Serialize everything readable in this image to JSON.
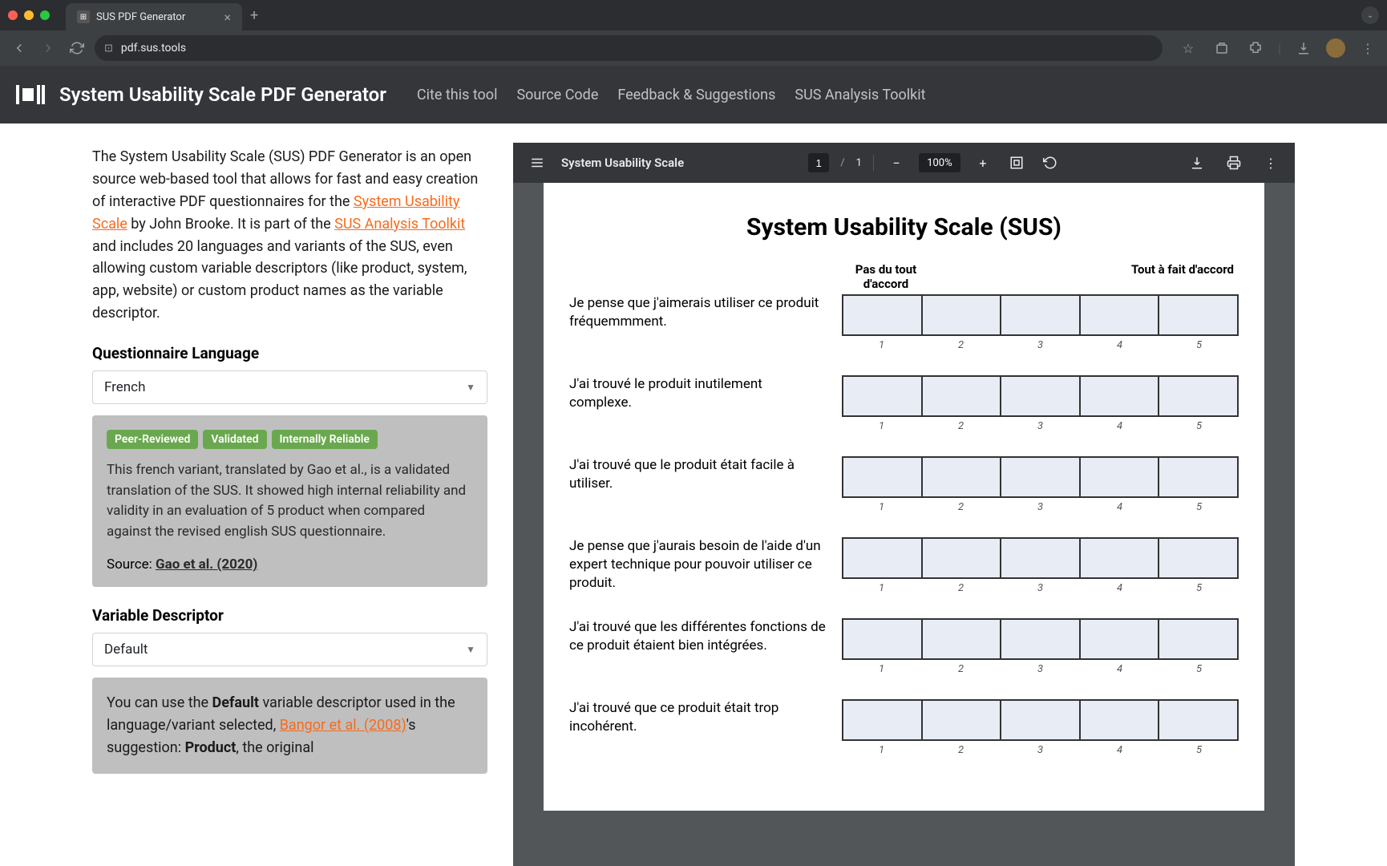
{
  "browser": {
    "tab_title": "SUS PDF Generator",
    "url": "pdf.sus.tools"
  },
  "app": {
    "title": "System Usability Scale PDF Generator",
    "nav": [
      "Cite this tool",
      "Source Code",
      "Feedback & Suggestions",
      "SUS Analysis Toolkit"
    ]
  },
  "intro": {
    "p1a": "The System Usability Scale (SUS) PDF Generator is an open source web-based tool that allows for fast and easy creation of interactive PDF questionnaires for the ",
    "link1": "System Usability Scale",
    "p1b": " by John Brooke. It is part of the ",
    "link2": "SUS Analysis Toolkit",
    "p1c": " and includes 20 languages and variants of the SUS, even allowing custom variable descriptors (like product, system, app, website) or custom product names as the variable descriptor."
  },
  "lang": {
    "heading": "Questionnaire Language",
    "selected": "French",
    "badges": [
      "Peer-Reviewed",
      "Validated",
      "Internally Reliable"
    ],
    "info": "This french variant, translated by Gao et al., is a validated translation of the SUS. It showed high internal reliability and validity in an evaluation of 5 product when compared against the revised english SUS questionnaire.",
    "source_label": "Source: ",
    "source_link": "Gao et al. (2020)"
  },
  "vardesc": {
    "heading": "Variable Descriptor",
    "selected": "Default",
    "p_a": "You can use the ",
    "p_bold1": "Default",
    "p_b": " variable descriptor used in the language/variant selected, ",
    "link": "Bangor et al. (2008)",
    "p_c": "'s suggestion: ",
    "p_bold2": "Product",
    "p_d": ", the original"
  },
  "pdf": {
    "doc_title": "System Usability Scale",
    "page_current": "1",
    "page_sep": "/",
    "page_total": "1",
    "zoom": "100%",
    "title": "System Usability Scale (SUS)",
    "anchor_left": "Pas du tout d'accord",
    "anchor_right": "Tout à fait d'accord",
    "scale": [
      "1",
      "2",
      "3",
      "4",
      "5"
    ],
    "questions": [
      "Je pense que j'aimerais utiliser ce produit fréquemmment.",
      "J'ai trouvé le produit inutilement complexe.",
      "J'ai trouvé que le produit était facile à utiliser.",
      "Je pense que j'aurais besoin de l'aide d'un expert technique pour pouvoir utiliser ce produit.",
      "J'ai trouvé que les différentes fonctions de ce produit étaient bien intégrées.",
      "J'ai trouvé que ce produit était trop incohérent."
    ]
  }
}
